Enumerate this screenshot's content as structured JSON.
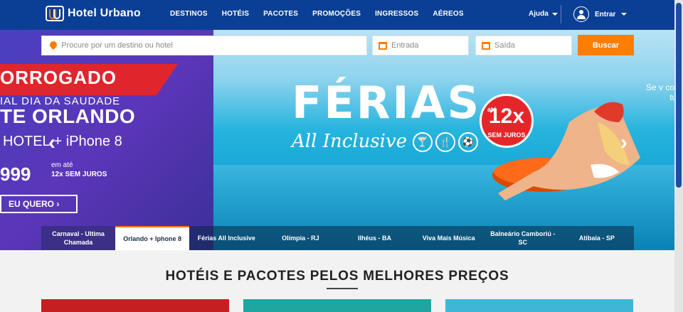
{
  "header": {
    "logo_text": "Hotel Urbano",
    "nav": [
      "DESTINOS",
      "HOTÉIS",
      "PACOTES",
      "PROMOÇÕES",
      "INGRESSOS",
      "AÉREOS"
    ],
    "help_label": "Ajuda",
    "login_label": "Entrar"
  },
  "search": {
    "destination_placeholder": "Procure por um destino ou hotel",
    "checkin_placeholder": "Entrada",
    "checkout_placeholder": "Saída",
    "button_label": "Buscar"
  },
  "banner_left": {
    "headline": "ORROGADO",
    "subline": "IAL DIA DA SAUDADE",
    "title": "TE ORLANDO",
    "offer": "HOTEL + iPhone 8",
    "price": "999",
    "installments_line1": "em até",
    "installments_line2": "12x SEM JUROS",
    "cta": "EU QUERO"
  },
  "banner_main": {
    "title": "FÉRIAS",
    "subtitle": "All Inclusive",
    "badge_prefix": "até",
    "badge_value": "12x",
    "badge_suffix": "SEM JUROS",
    "partial_text": "Se v com tud"
  },
  "carousel_tabs": [
    "Carnaval - Ultima Chamada",
    "Orlando + Iphone 8",
    "Férias All Inclusive",
    "Olímpia - RJ",
    "Ilhéus - BA",
    "Viva Mais Música",
    "Balneário Camboriú - SC",
    "Atibaia - SP"
  ],
  "section": {
    "title": "HOTÉIS E PACOTES PELOS MELHORES PREÇOS"
  },
  "colors": {
    "header_blue": "#0b3f95",
    "accent_orange": "#ff7d00",
    "badge_red": "#e4262b"
  }
}
